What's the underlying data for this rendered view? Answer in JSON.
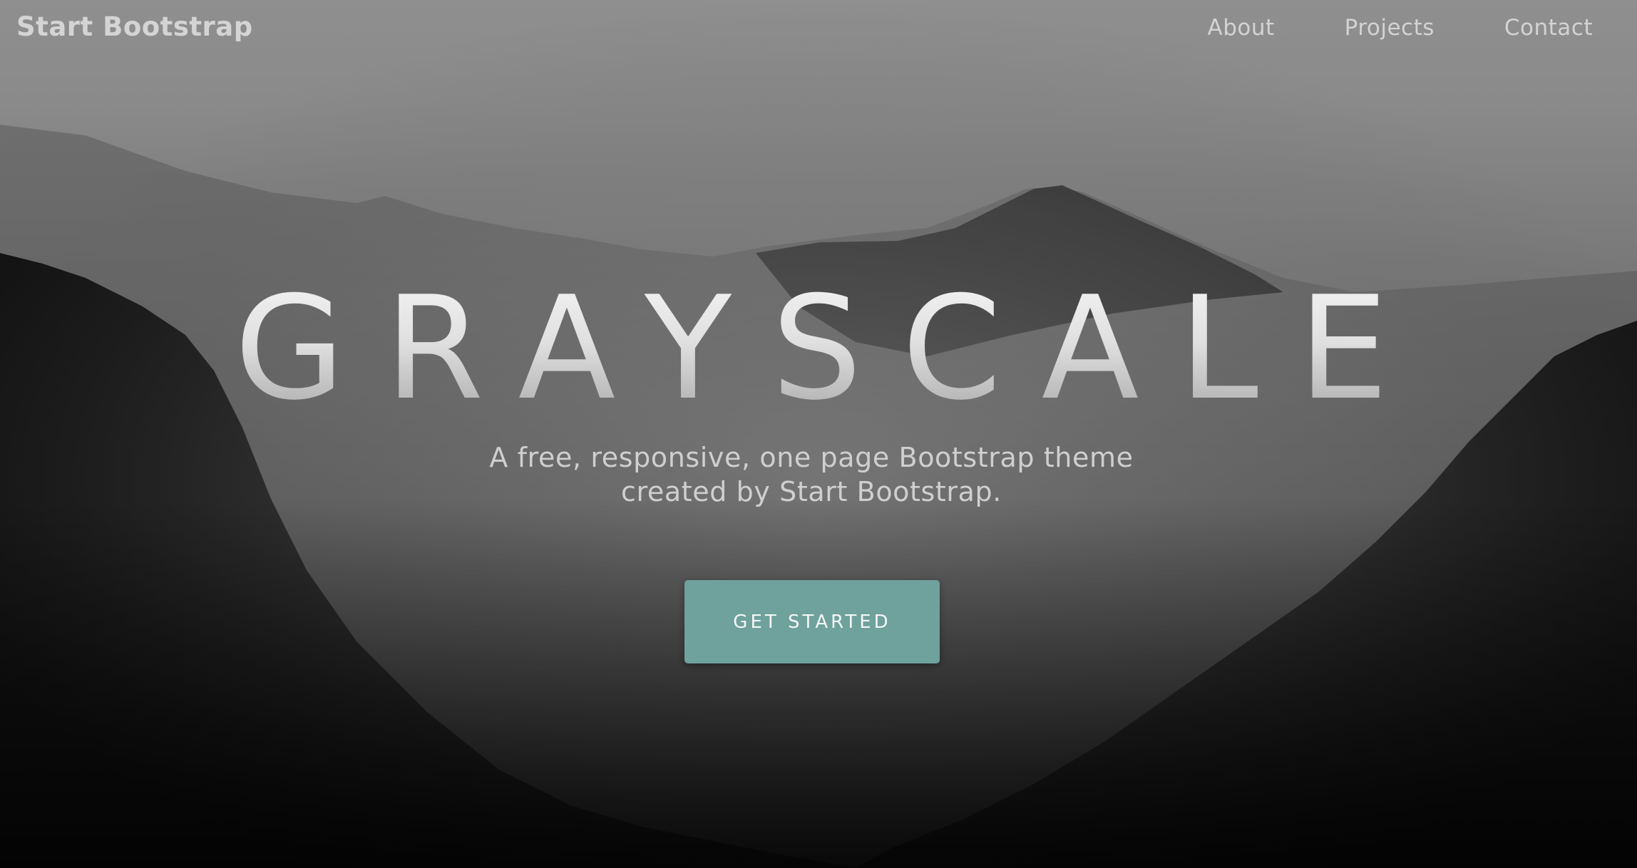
{
  "navbar": {
    "brand": "Start Bootstrap",
    "links": [
      {
        "label": "About"
      },
      {
        "label": "Projects"
      },
      {
        "label": "Contact"
      }
    ]
  },
  "hero": {
    "title": "GRAYSCALE",
    "subtitle": "A free, responsive, one page Bootstrap theme created by Start Bootstrap.",
    "button_label": "GET STARTED"
  },
  "colors": {
    "accent": "#6fa19d",
    "nav_text": "#d3d3d3",
    "title_text": "#e4e4e4",
    "subtitle_text": "#cfcfcf"
  }
}
